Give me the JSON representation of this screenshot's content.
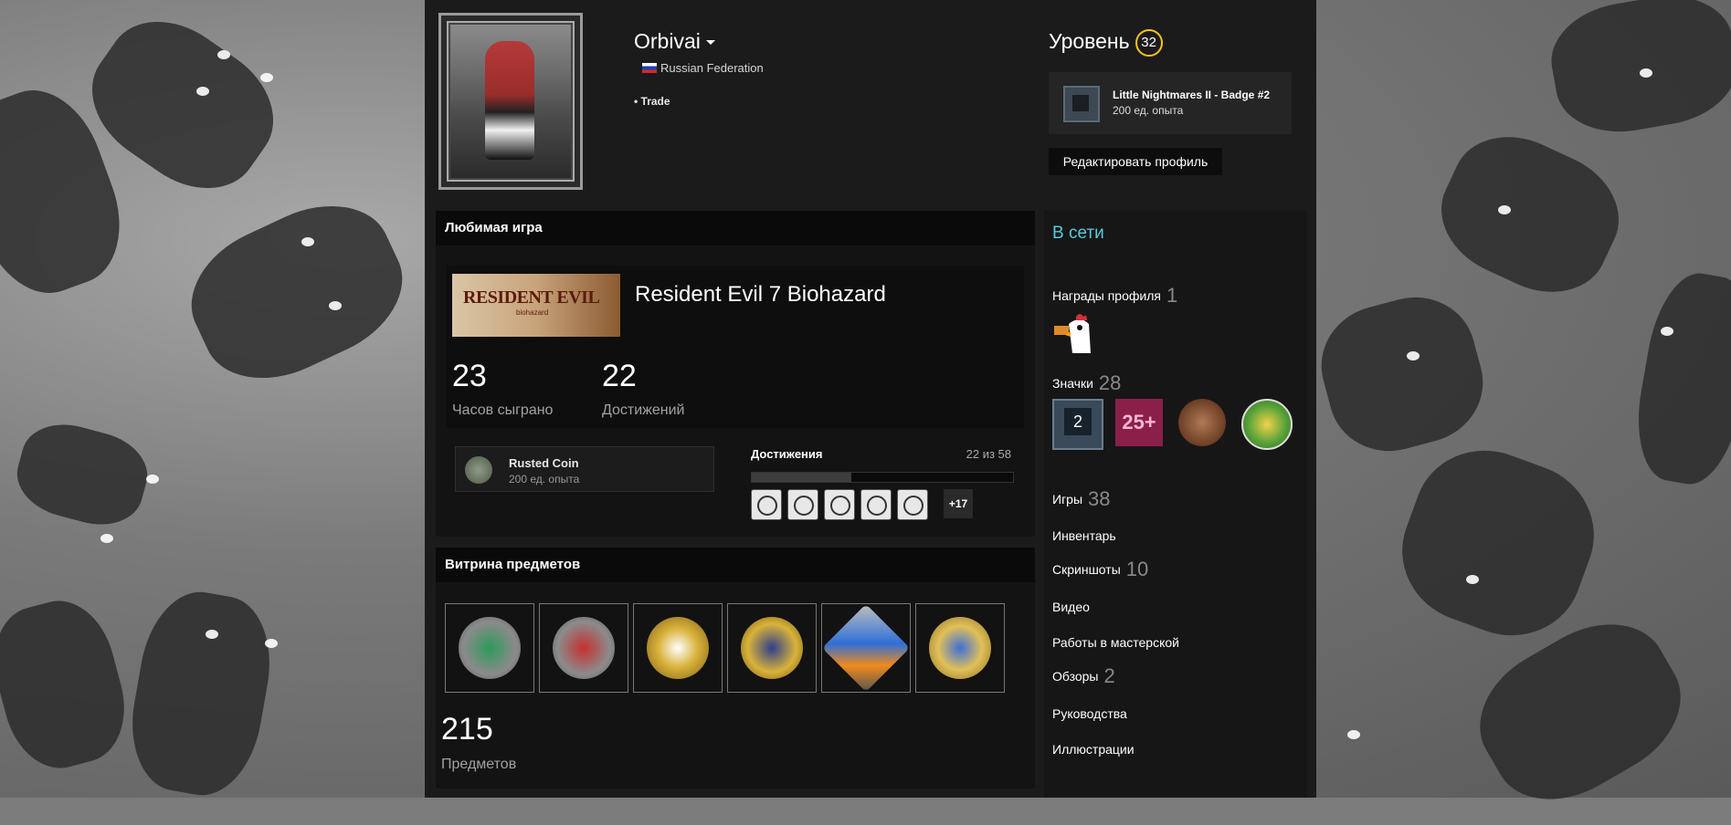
{
  "profile": {
    "username": "Orbivai",
    "country": "Russian Federation",
    "tag": "• Trade"
  },
  "level": {
    "title": "Уровень",
    "value": "32",
    "badge": {
      "name": "Little Nightmares II - Badge #2",
      "xp": "200 ед. опыта"
    },
    "edit_button": "Редактировать профиль"
  },
  "favorite_game": {
    "header": "Любимая игра",
    "capsule_text": "RESIDENT EVIL",
    "capsule_sub": "biohazard",
    "title": "Resident Evil 7 Biohazard",
    "hours": "23",
    "hours_label": "Часов сыграно",
    "achievements": "22",
    "achievements_label": "Достижений",
    "coin": {
      "name": "Rusted Coin",
      "xp": "200 ед. опыта"
    },
    "ach_title": "Достижения",
    "ach_progress": "22 из 58",
    "ach_fraction": 0.38,
    "ach_more": "+17"
  },
  "showcase": {
    "header": "Витрина предметов",
    "count": "215",
    "count_label": "Предметов"
  },
  "sidebar": {
    "status": "В сети",
    "awards": {
      "label": "Награды профиля",
      "count": "1"
    },
    "badges": {
      "label": "Значки",
      "count": "28",
      "badge1_text": "2",
      "badge2_text": "25+"
    },
    "links": [
      {
        "label": "Игры",
        "count": "38"
      },
      {
        "label": "Инвентарь",
        "count": ""
      },
      {
        "label": "Скриншоты",
        "count": "10"
      },
      {
        "label": "Видео",
        "count": ""
      },
      {
        "label": "Работы в мастерской",
        "count": ""
      },
      {
        "label": "Обзоры",
        "count": "2"
      },
      {
        "label": "Руководства",
        "count": ""
      },
      {
        "label": "Иллюстрации",
        "count": ""
      }
    ]
  },
  "colors": {
    "online": "#57cbde",
    "level_ring": "#f5c518",
    "page_bg": "#1b1b1b"
  }
}
